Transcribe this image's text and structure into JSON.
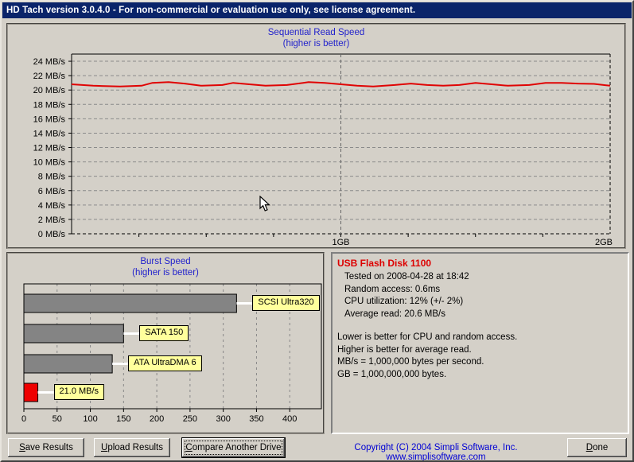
{
  "window": {
    "title": "HD Tach version 3.0.4.0  - For non-commercial or evaluation use only, see license agreement."
  },
  "colors": {
    "titlebar": "#0A246A",
    "chart_title_blue": "#2222CC",
    "line": "#E00404",
    "bar_gray": "#848484",
    "bar_red": "#EE0000",
    "label_yellow": "#FFFF9C",
    "drive_red": "#DD0000",
    "copyright_blue": "#0000D4",
    "window_bg": "#D4D0C8"
  },
  "chart_data": [
    {
      "type": "line",
      "title": "Sequential Read Speed",
      "subtitle": "(higher is better)",
      "y_unit": "MB/s",
      "y_ticks": [
        0,
        2,
        4,
        6,
        8,
        10,
        12,
        14,
        16,
        18,
        20,
        22,
        24
      ],
      "ylim": [
        0,
        25
      ],
      "x_ticks": [
        {
          "frac": 0.5,
          "label": "1GB"
        },
        {
          "frac": 1.0,
          "label": "2GB"
        }
      ],
      "xlim_gb": [
        0,
        2
      ],
      "grid": "dashed",
      "series": [
        {
          "name": "sequential-read-MB/s",
          "points": [
            [
              0.0,
              20.8
            ],
            [
              0.04,
              20.6
            ],
            [
              0.09,
              20.5
            ],
            [
              0.13,
              20.6
            ],
            [
              0.15,
              21.0
            ],
            [
              0.18,
              21.1
            ],
            [
              0.21,
              20.9
            ],
            [
              0.24,
              20.6
            ],
            [
              0.28,
              20.7
            ],
            [
              0.3,
              21.0
            ],
            [
              0.33,
              20.8
            ],
            [
              0.36,
              20.6
            ],
            [
              0.4,
              20.7
            ],
            [
              0.44,
              21.1
            ],
            [
              0.47,
              21.0
            ],
            [
              0.5,
              20.8
            ],
            [
              0.53,
              20.6
            ],
            [
              0.56,
              20.5
            ],
            [
              0.6,
              20.7
            ],
            [
              0.63,
              20.9
            ],
            [
              0.66,
              20.7
            ],
            [
              0.69,
              20.6
            ],
            [
              0.72,
              20.7
            ],
            [
              0.75,
              21.0
            ],
            [
              0.78,
              20.8
            ],
            [
              0.81,
              20.6
            ],
            [
              0.85,
              20.7
            ],
            [
              0.88,
              21.0
            ],
            [
              0.91,
              21.0
            ],
            [
              0.94,
              20.9
            ],
            [
              0.97,
              20.85
            ],
            [
              1.0,
              20.6
            ]
          ]
        }
      ]
    },
    {
      "type": "bar",
      "title": "Burst Speed",
      "subtitle": "(higher is better)",
      "orientation": "horizontal",
      "xlim": [
        0,
        445
      ],
      "x_ticks": [
        0,
        50,
        100,
        150,
        200,
        250,
        300,
        350,
        400
      ],
      "grid": "dashed",
      "bars": [
        {
          "label": "SCSI Ultra320",
          "value": 320,
          "color": "gray"
        },
        {
          "label": "SATA 150",
          "value": 150,
          "color": "gray"
        },
        {
          "label": "ATA UltraDMA 6",
          "value": 133,
          "color": "gray"
        },
        {
          "label": "21.0 MB/s",
          "value": 21,
          "color": "red"
        }
      ]
    }
  ],
  "info": {
    "drive": "USB Flash Disk 1100",
    "lines": [
      "Tested on 2008-04-28 at 18:42",
      "Random access: 0.6ms",
      "CPU utilization: 12% (+/- 2%)",
      "Average read: 20.6 MB/s"
    ],
    "notes": [
      "Lower is better for CPU and random access.",
      "Higher is better for average read.",
      "MB/s = 1,000,000 bytes per second.",
      "GB = 1,000,000,000 bytes."
    ]
  },
  "buttons": {
    "save": {
      "hotkey": "S",
      "rest": "ave Results"
    },
    "upload": {
      "hotkey": "U",
      "rest": "pload Results"
    },
    "compare": {
      "hotkey": "C",
      "rest": "ompare Another Drive"
    },
    "done": {
      "hotkey": "D",
      "rest": "one"
    }
  },
  "footer": {
    "copyright": "Copyright (C) 2004 Simpli Software, Inc. www.simplisoftware.com"
  }
}
